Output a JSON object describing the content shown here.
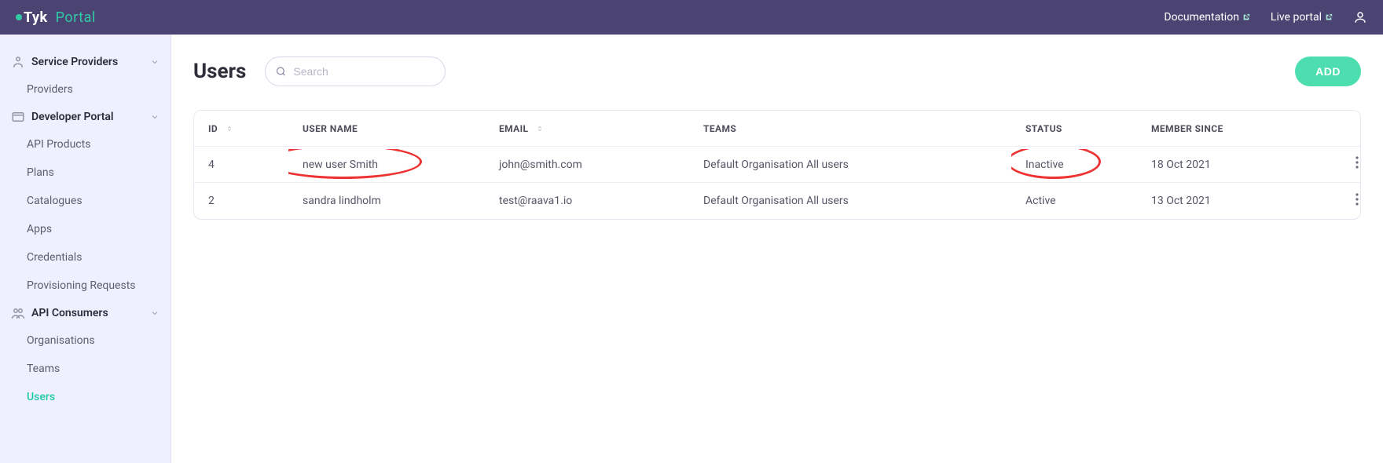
{
  "header": {
    "brand_tyk": "Tyk",
    "brand_portal": "Portal",
    "links": {
      "documentation": "Documentation",
      "live_portal": "Live portal"
    }
  },
  "sidebar": {
    "groups": [
      {
        "label": "Service Providers",
        "items": [
          {
            "label": "Providers",
            "active": false
          }
        ]
      },
      {
        "label": "Developer Portal",
        "items": [
          {
            "label": "API Products",
            "active": false
          },
          {
            "label": "Plans",
            "active": false
          },
          {
            "label": "Catalogues",
            "active": false
          },
          {
            "label": "Apps",
            "active": false
          },
          {
            "label": "Credentials",
            "active": false
          },
          {
            "label": "Provisioning Requests",
            "active": false
          }
        ]
      },
      {
        "label": "API Consumers",
        "items": [
          {
            "label": "Organisations",
            "active": false
          },
          {
            "label": "Teams",
            "active": false
          },
          {
            "label": "Users",
            "active": true
          }
        ]
      }
    ]
  },
  "page": {
    "title": "Users",
    "search_placeholder": "Search",
    "add_button": "ADD"
  },
  "table": {
    "columns": {
      "id": "ID",
      "user_name": "USER NAME",
      "email": "EMAIL",
      "teams": "TEAMS",
      "status": "STATUS",
      "member_since": "MEMBER SINCE"
    },
    "rows": [
      {
        "id": "4",
        "user_name": "new user Smith",
        "email": "john@smith.com",
        "teams": "Default Organisation All users",
        "status": "Inactive",
        "member_since": "18 Oct 2021"
      },
      {
        "id": "2",
        "user_name": "sandra lindholm",
        "email": "test@raava1.io",
        "teams": "Default Organisation All users",
        "status": "Active",
        "member_since": "13 Oct 2021"
      }
    ]
  }
}
